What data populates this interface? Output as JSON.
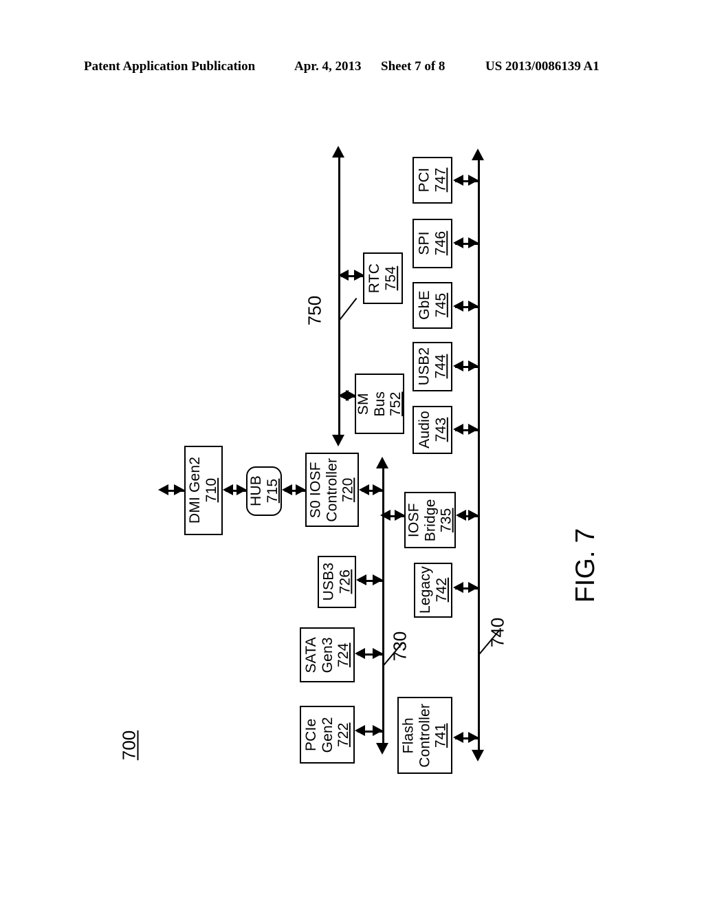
{
  "header": {
    "publication": "Patent Application Publication",
    "date": "Apr. 4, 2013",
    "sheet": "Sheet 7 of 8",
    "number": "US 2013/0086139 A1"
  },
  "figure": {
    "caption": "FIG. 7",
    "system_ref": "700",
    "colors": {
      "ink": "#000000",
      "paper": "#ffffff"
    }
  },
  "diagram": {
    "type": "block-diagram",
    "title": "FIG. 7",
    "blocks": [
      {
        "id": "b710",
        "name": "dmi-gen2",
        "label": "DMI Gen2",
        "ref": "710",
        "shape": "rect"
      },
      {
        "id": "b715",
        "name": "hub",
        "label": "HUB",
        "ref": "715",
        "shape": "rounded-rect"
      },
      {
        "id": "b720",
        "name": "s0-iosf-controller",
        "label": "S0 IOSF\nController",
        "ref": "720",
        "shape": "rect"
      },
      {
        "id": "b722",
        "name": "pcie-gen2",
        "label": "PCIe\nGen2",
        "ref": "722",
        "shape": "rect"
      },
      {
        "id": "b724",
        "name": "sata-gen3",
        "label": "SATA\nGen3",
        "ref": "724",
        "shape": "rect"
      },
      {
        "id": "b726",
        "name": "usb3",
        "label": "USB3",
        "ref": "726",
        "shape": "rect"
      },
      {
        "id": "b735",
        "name": "iosf-bridge",
        "label": "IOSF\nBridge",
        "ref": "735",
        "shape": "rect"
      },
      {
        "id": "b741",
        "name": "flash-controller",
        "label": "Flash\nController",
        "ref": "741",
        "shape": "rect"
      },
      {
        "id": "b742",
        "name": "legacy",
        "label": "Legacy",
        "ref": "742",
        "shape": "rect"
      },
      {
        "id": "b743",
        "name": "audio",
        "label": "Audio",
        "ref": "743",
        "shape": "rect"
      },
      {
        "id": "b744",
        "name": "usb2",
        "label": "USB2",
        "ref": "744",
        "shape": "rect"
      },
      {
        "id": "b745",
        "name": "gbe",
        "label": "GbE",
        "ref": "745",
        "shape": "rect"
      },
      {
        "id": "b746",
        "name": "spi",
        "label": "SPI",
        "ref": "746",
        "shape": "rect"
      },
      {
        "id": "b747",
        "name": "pci",
        "label": "PCI",
        "ref": "747",
        "shape": "rect"
      },
      {
        "id": "b752",
        "name": "sm-bus",
        "label": "SM\nBus",
        "ref": "752",
        "shape": "rect"
      },
      {
        "id": "b754",
        "name": "rtc",
        "label": "RTC",
        "ref": "754",
        "shape": "rect"
      }
    ],
    "buses": [
      {
        "id": "bus730",
        "name": "primary-iosf-bus",
        "ref": "730",
        "attached": [
          "b720",
          "b722",
          "b724",
          "b726",
          "b735"
        ]
      },
      {
        "id": "bus740",
        "name": "secondary-iosf-bus",
        "ref": "740",
        "attached": [
          "b735",
          "b741",
          "b742",
          "b743",
          "b744",
          "b745",
          "b746",
          "b747"
        ]
      },
      {
        "id": "bus750",
        "name": "sideband-bus",
        "ref": "750",
        "attached": [
          "b752",
          "b754"
        ]
      }
    ],
    "labels": {
      "b710": {
        "text": "DMI Gen2",
        "ref": "710"
      },
      "b715": {
        "text": "HUB",
        "ref": "715"
      },
      "b720": {
        "line1": "S0 IOSF",
        "line2": "Controller",
        "ref": "720"
      },
      "b722": {
        "line1": "PCIe",
        "line2": "Gen2",
        "ref": "722"
      },
      "b724": {
        "line1": "SATA",
        "line2": "Gen3",
        "ref": "724"
      },
      "b726": {
        "text": "USB3",
        "ref": "726"
      },
      "b735": {
        "line1": "IOSF",
        "line2": "Bridge",
        "ref": "735"
      },
      "b741": {
        "line1": "Flash",
        "line2": "Controller",
        "ref": "741"
      },
      "b742": {
        "text": "Legacy",
        "ref": "742"
      },
      "b743": {
        "text": "Audio",
        "ref": "743"
      },
      "b744": {
        "text": "USB2",
        "ref": "744"
      },
      "b745": {
        "text": "GbE",
        "ref": "745"
      },
      "b746": {
        "text": "SPI",
        "ref": "746"
      },
      "b747": {
        "text": "PCI",
        "ref": "747"
      },
      "b752": {
        "line1": "SM",
        "line2": "Bus",
        "ref": "752"
      },
      "b754": {
        "text": "RTC",
        "ref": "754"
      }
    },
    "bus_refs": {
      "bus730": "730",
      "bus740": "740",
      "bus750": "750"
    }
  }
}
